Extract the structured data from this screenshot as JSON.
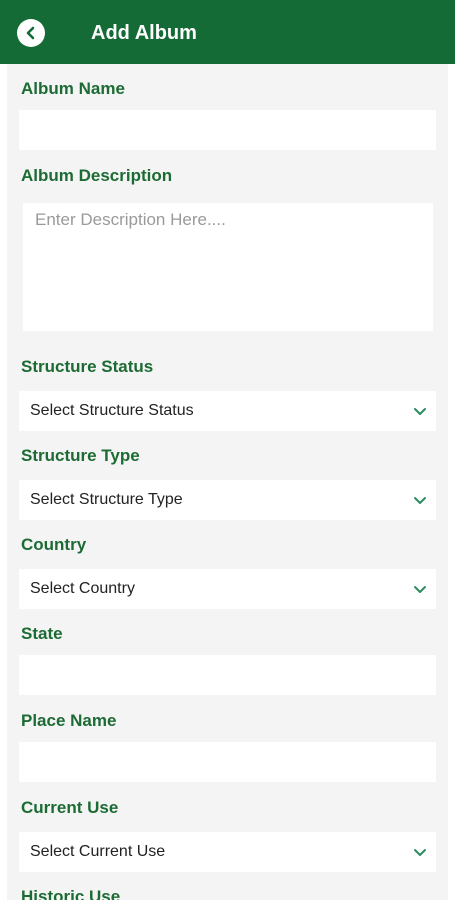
{
  "header": {
    "title": "Add Album",
    "back_icon": "chevron-left-icon",
    "color": "#146b36"
  },
  "form": {
    "album_name": {
      "label": "Album Name",
      "value": ""
    },
    "album_description": {
      "label": "Album Description",
      "placeholder": "Enter Description Here...."
    },
    "structure_status": {
      "label": "Structure Status",
      "value": "Select Structure Status"
    },
    "structure_type": {
      "label": "Structure Type",
      "value": "Select Structure Type"
    },
    "country": {
      "label": "Country",
      "value": "Select Country"
    },
    "state": {
      "label": "State",
      "value": ""
    },
    "place_name": {
      "label": "Place Name",
      "value": ""
    },
    "current_use": {
      "label": "Current Use",
      "value": "Select Current Use"
    },
    "historic_use": {
      "label": "Historic Use"
    }
  },
  "colors": {
    "label": "#1d6b34",
    "chevron": "#2a8c5f",
    "background": "#f4f4f4"
  }
}
